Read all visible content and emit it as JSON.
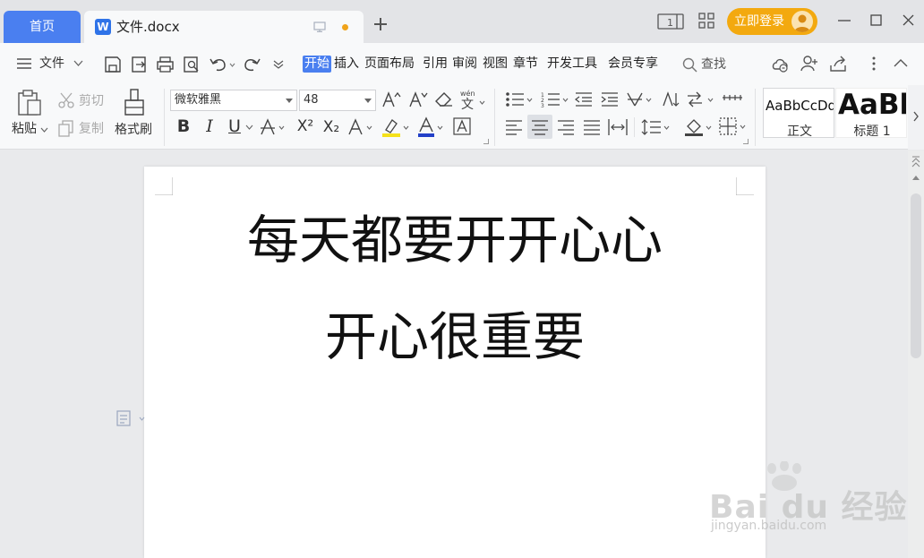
{
  "titlebar": {
    "home_tab": "首页",
    "doc_tab_icon": "W",
    "doc_tab_title": "文件.docx",
    "login_label": "立即登录",
    "unsaved_dot_color": "#f0a31a"
  },
  "menubar": {
    "file_label": "文件",
    "items": [
      "开始",
      "插入",
      "页面布局",
      "引用",
      "审阅",
      "视图",
      "章节",
      "开发工具",
      "会员专享"
    ],
    "active_item": "开始",
    "search_label": "查找"
  },
  "ribbon": {
    "paste_label": "粘贴",
    "cut_label": "剪切",
    "copy_label": "复制",
    "format_painter_label": "格式刷",
    "font_name": "微软雅黑",
    "font_size": "48",
    "buttons": {
      "bold": "B",
      "italic": "I",
      "underline": "U",
      "superscript": "X²",
      "subscript": "X₂"
    },
    "styles": [
      {
        "sample": "AaBbCcDd",
        "name": "正文"
      },
      {
        "sample": "AaBl",
        "name": "标题 1"
      }
    ]
  },
  "document": {
    "paragraphs": [
      "每天都要开开心心",
      "开心很重要"
    ]
  },
  "watermark": {
    "logo": "Bai du 经验",
    "url": "jingyan.baidu.com"
  },
  "colors": {
    "accent": "#4a7ff0",
    "login_bg": "#f3a90f",
    "word_icon": "#2f73e8"
  }
}
